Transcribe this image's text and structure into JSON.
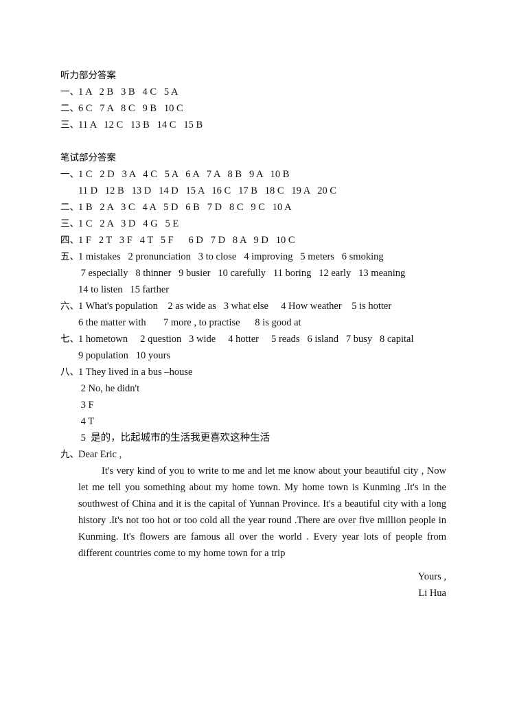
{
  "document": {
    "listening_heading": "听力部分答案",
    "written_heading": "笔试部分答案"
  },
  "listening": {
    "rows": [
      {
        "marker": "一、",
        "items": "1 A   2 B   3 B   4 C   5 A"
      },
      {
        "marker": "二、",
        "items": "6 C   7 A   8 C   9 B   10 C"
      },
      {
        "marker": "三、",
        "items": "11 A   12 C   13 B   14 C   15 B"
      }
    ]
  },
  "written": {
    "rows": [
      {
        "marker": "一、",
        "items": "1 C   2 D   3 A   4 C   5 A   6 A   7 A   8 B   9 A   10 B"
      },
      {
        "marker": "",
        "items": "11 D   12 B   13 D   14 D   15 A   16 C   17 B   18 C   19 A   20 C"
      },
      {
        "marker": "二、",
        "items": "1 B   2 A   3 C   4 A   5 D   6 B   7 D   8 C   9 C   10 A"
      },
      {
        "marker": "三、",
        "items": "1 C   2 A   3 D   4 G   5 E"
      },
      {
        "marker": "四、",
        "items": "1 F   2 T   3 F   4 T   5 F      6 D   7 D   8 A   9 D   10 C"
      },
      {
        "marker": "五、",
        "items": "1 mistakes   2 pronunciation   3 to close   4 improving   5 meters   6 smoking"
      },
      {
        "marker": "",
        "items": " 7 especially   8 thinner   9 busier   10 carefully   11 boring   12 early   13 meaning"
      },
      {
        "marker": "",
        "items": "14 to listen   15 farther"
      },
      {
        "marker": "六、",
        "items": "1 What's population    2 as wide as   3 what else     4 How weather    5 is hotter"
      },
      {
        "marker": "",
        "items": "6 the matter with       7 more , to practise      8 is good at"
      },
      {
        "marker": "七、",
        "items": "1 hometown     2 question   3 wide     4 hotter     5 reads   6 island   7 busy   8 capital"
      },
      {
        "marker": "",
        "items": "9 population   10 yours"
      },
      {
        "marker": "八、",
        "items": "1 They lived in a bus –house"
      },
      {
        "marker": "",
        "items": " 2 No, he didn't"
      },
      {
        "marker": "",
        "items": " 3 F"
      },
      {
        "marker": "",
        "items": " 4 T"
      },
      {
        "marker": "",
        "items": " 5  是的，比起城市的生活我更喜欢这种生活",
        "chinese": true
      }
    ]
  },
  "letter": {
    "marker": "九、",
    "salutation": "Dear Eric ,",
    "body": "It's very kind of you to write to me and let me know about your beautiful city , Now let me tell you something about my home town. My home town is Kunming .It's in the southwest of China and it is the capital of Yunnan Province. It's a beautiful city with a long history .It's not too hot or too cold all the year round .There are over five million people in Kunming. It's flowers are famous all over the world . Every year lots of people from different countries come to my home town for a trip",
    "sign_off": "Yours ,",
    "sign_name": "Li Hua"
  }
}
